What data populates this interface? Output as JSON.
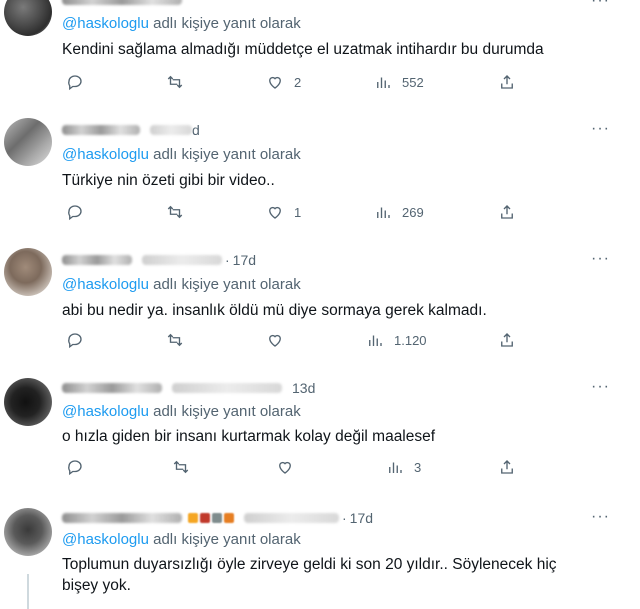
{
  "tweets": [
    {
      "time": "",
      "reply_prefix": "",
      "reply_handle": "@haskologlu",
      "reply_suffix": " adlı kişiye yanıt olarak",
      "text": "Kendini sağlama almadığı müddetçe el uzatmak intihardır bu durumda",
      "replies": "",
      "retweets": "",
      "likes": "2",
      "views": "552"
    },
    {
      "time": "d",
      "reply_handle": "@haskologlu",
      "reply_suffix": " adlı kişiye yanıt olarak",
      "text": "Türkiye nin özeti gibi bir video..",
      "replies": "",
      "retweets": "",
      "likes": "1",
      "views": "269"
    },
    {
      "time": "17d",
      "reply_handle": "@haskologlu",
      "reply_suffix": " adlı kişiye yanıt olarak",
      "text": "abi bu nedir ya. insanlık öldü mü diye sormaya gerek kalmadı.",
      "replies": "",
      "retweets": "",
      "likes": "",
      "views": "1.120"
    },
    {
      "time": "13d",
      "reply_handle": "@haskologlu",
      "reply_suffix": " adlı kişiye yanıt olarak",
      "text": "o hızla giden bir insanı kurtarmak kolay değil maalesef",
      "replies": "",
      "retweets": "",
      "likes": "",
      "views": "3"
    },
    {
      "time": "17d",
      "reply_handle": "@haskologlu",
      "reply_suffix": " adlı kişiye yanıt olarak",
      "text_line1": "Toplumun duyarsızlığı öyle zirveye geldi ki son 20 yıldır.. Söylenecek hiç",
      "text_line2": "bişey yok."
    }
  ],
  "ui": {
    "dot": "·",
    "more": "···"
  },
  "colors": {
    "link": "#1d9bf0",
    "muted": "#536471",
    "text": "#0f1419"
  },
  "icons": [
    "reply-icon",
    "retweet-icon",
    "like-icon",
    "views-icon",
    "share-icon",
    "more-icon"
  ]
}
